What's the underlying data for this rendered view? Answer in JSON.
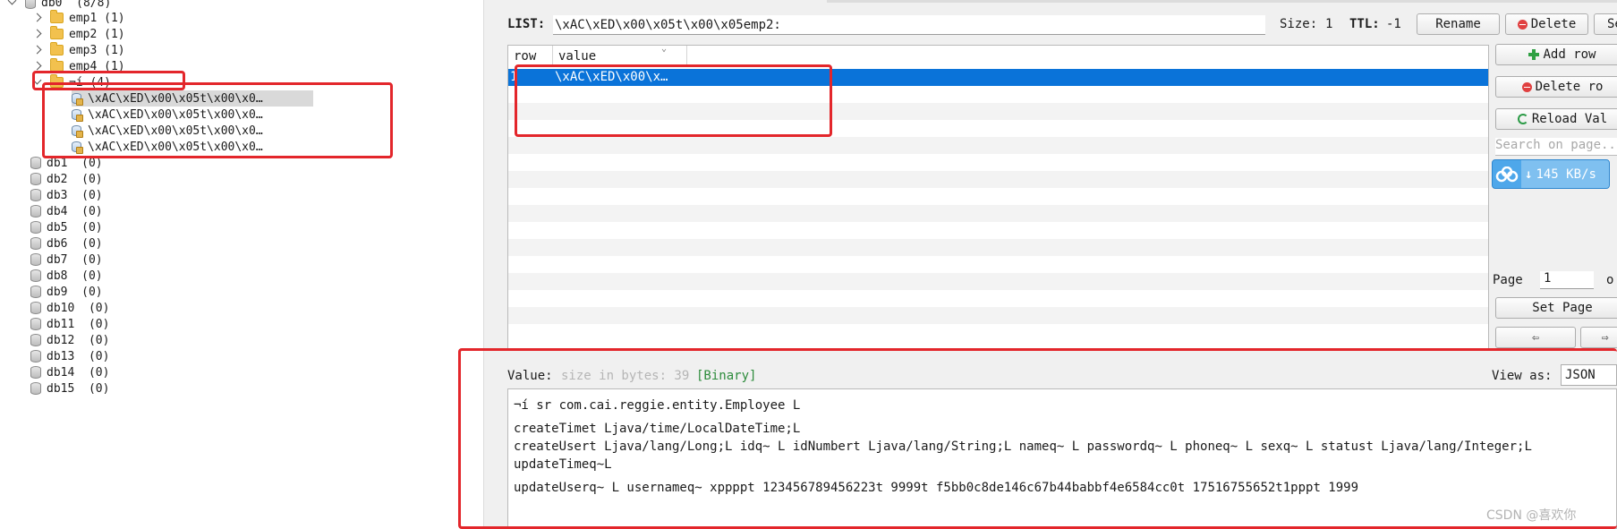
{
  "tree": {
    "db0": {
      "name": "db0",
      "count": "(8/8)"
    },
    "folders": [
      {
        "name": "emp1",
        "count": "(1)"
      },
      {
        "name": "emp2",
        "count": "(1)"
      },
      {
        "name": "emp3",
        "count": "(1)"
      },
      {
        "name": "emp4",
        "count": "(1)"
      }
    ],
    "open_folder": {
      "name": "¬í",
      "count": "(4)"
    },
    "keys": [
      "\\xAC\\xED\\x00\\x05t\\x00\\x0…",
      "\\xAC\\xED\\x00\\x05t\\x00\\x0…",
      "\\xAC\\xED\\x00\\x05t\\x00\\x0…",
      "\\xAC\\xED\\x00\\x05t\\x00\\x0…"
    ],
    "dbs": [
      {
        "name": "db1",
        "count": "(0)"
      },
      {
        "name": "db2",
        "count": "(0)"
      },
      {
        "name": "db3",
        "count": "(0)"
      },
      {
        "name": "db4",
        "count": "(0)"
      },
      {
        "name": "db5",
        "count": "(0)"
      },
      {
        "name": "db6",
        "count": "(0)"
      },
      {
        "name": "db7",
        "count": "(0)"
      },
      {
        "name": "db8",
        "count": "(0)"
      },
      {
        "name": "db9",
        "count": "(0)"
      },
      {
        "name": "db10",
        "count": "(0)"
      },
      {
        "name": "db11",
        "count": "(0)"
      },
      {
        "name": "db12",
        "count": "(0)"
      },
      {
        "name": "db13",
        "count": "(0)"
      },
      {
        "name": "db14",
        "count": "(0)"
      },
      {
        "name": "db15",
        "count": "(0)"
      }
    ]
  },
  "header": {
    "type_label": "LIST:",
    "key_value": "\\xAC\\xED\\x00\\x05t\\x00\\x05emp2:",
    "size_label": "Size:",
    "size_value": "1",
    "ttl_label": "TTL:",
    "ttl_value": "-1",
    "rename": "Rename",
    "delete": "Delete",
    "set_ttl": "Se"
  },
  "table": {
    "columns": [
      "row",
      "value"
    ],
    "rows": [
      {
        "row": "1",
        "value": "\\xAC\\xED\\x00\\x…"
      }
    ]
  },
  "side": {
    "add_row": "Add row",
    "delete_row": "Delete ro",
    "reload": "Reload Val",
    "search_placeholder": "Search on page...",
    "speed": "145 KB/s",
    "page_label": "Page",
    "page_value": "1",
    "of_label": "o",
    "set_page": "Set Page",
    "prev": "⇦",
    "next": "⇨"
  },
  "value_panel": {
    "label": "Value:",
    "size_hint": "size in bytes: 39",
    "binary": "[Binary]",
    "view_as": "View as:",
    "format": "JSON",
    "lines": [
      "¬í sr com.cai.reggie.entity.Employee L",
      "createTimet Ljava/time/LocalDateTime;L",
      "createUsert Ljava/lang/Long;L idq~ L idNumbert Ljava/lang/String;L nameq~ L passwordq~ L phoneq~ L sexq~ L statust Ljava/lang/Integer;L",
      "updateTimeq~L",
      "updateUserq~ L usernameq~ xppppt 123456789456223t 9999t f5bb0c8de146c67b44babbf4e6584cc0t 17516755652t1pppt 1999"
    ]
  },
  "watermark": "CSDN @喜欢你"
}
